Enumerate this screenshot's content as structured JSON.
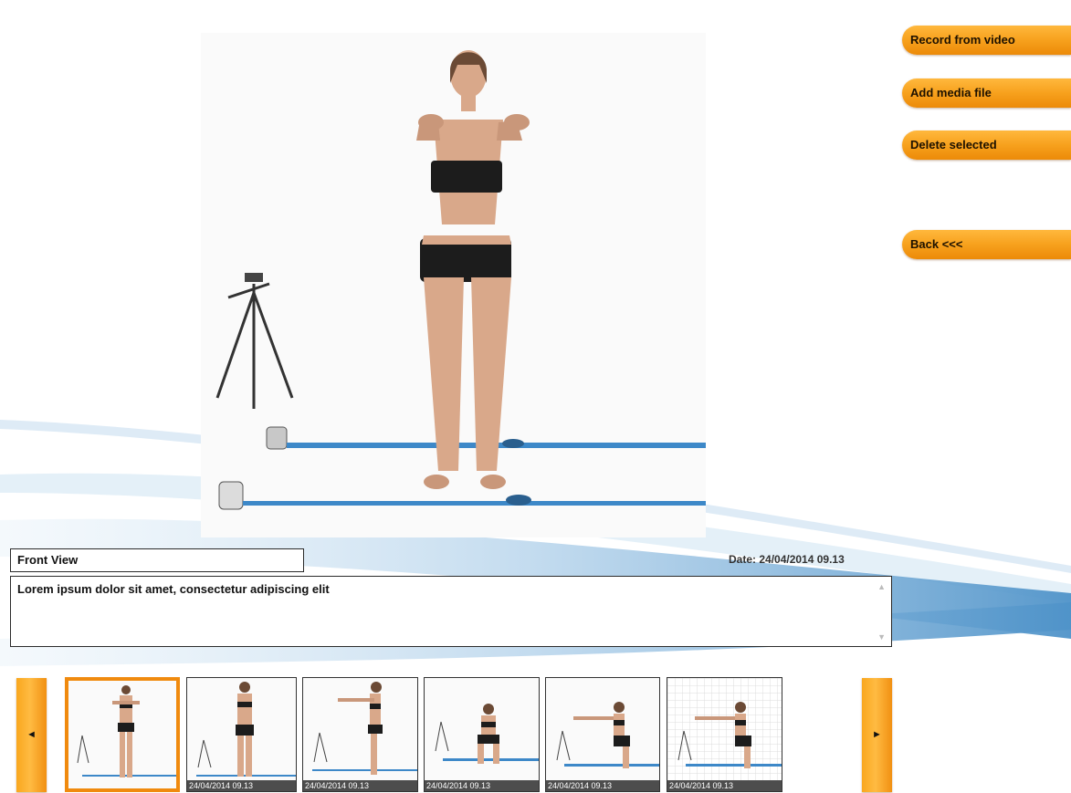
{
  "actions": {
    "record_from_video": "Record from video",
    "add_media_file": "Add media file",
    "delete_selected": "Delete selected",
    "back": "Back <<<"
  },
  "media": {
    "title": "Front View",
    "date": "Date: 24/04/2014 09.13",
    "notes": "Lorem ipsum dolor sit amet, consectetur adipiscing elit"
  },
  "gallery": {
    "prev_glyph": "◄",
    "next_glyph": "►",
    "selected_index": 0,
    "thumbnails": [
      {
        "view": "front-arms-raised",
        "timestamp": ""
      },
      {
        "view": "back",
        "timestamp": "24/04/2014 09.13"
      },
      {
        "view": "side-arms-raised",
        "timestamp": "24/04/2014 09.13"
      },
      {
        "view": "squat-front",
        "timestamp": "24/04/2014 09.13"
      },
      {
        "view": "squat-side",
        "timestamp": "24/04/2014 09.13"
      },
      {
        "view": "squat-side-grid",
        "timestamp": "24/04/2014 09.13"
      }
    ]
  },
  "colors": {
    "accent_orange": "#f7a11d",
    "selected_border": "#f08a0e",
    "swoosh_blue": "#6fa9d6"
  }
}
